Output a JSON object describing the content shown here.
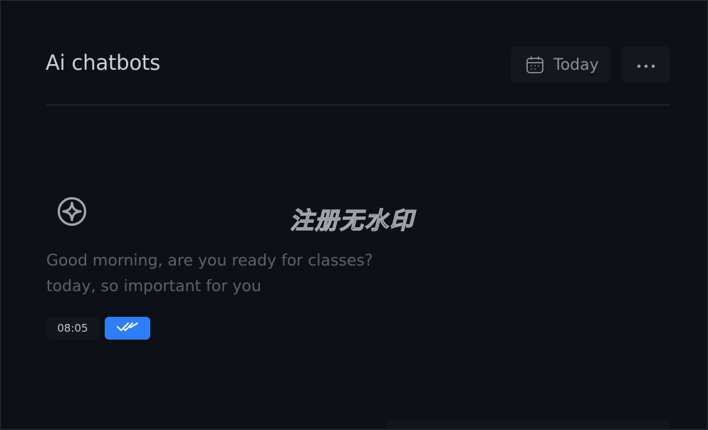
{
  "header": {
    "title": "Ai chatbots",
    "date_button": {
      "label": "Today",
      "icon": "calendar-icon"
    },
    "more_button": {
      "icon": "more-horizontal-icon"
    }
  },
  "watermark": {
    "text": "注册无水印"
  },
  "message": {
    "bot_icon": "chatbot-logo-icon",
    "lines": [
      "Good morning, are you ready for classes?",
      "today, so important for you"
    ],
    "time": "08:05",
    "status_icon": "double-check-icon"
  },
  "colors": {
    "background": "#0e1017",
    "accent": "#2d7ef7",
    "title": "#cfd1d6",
    "muted_text": "#5e616a"
  }
}
